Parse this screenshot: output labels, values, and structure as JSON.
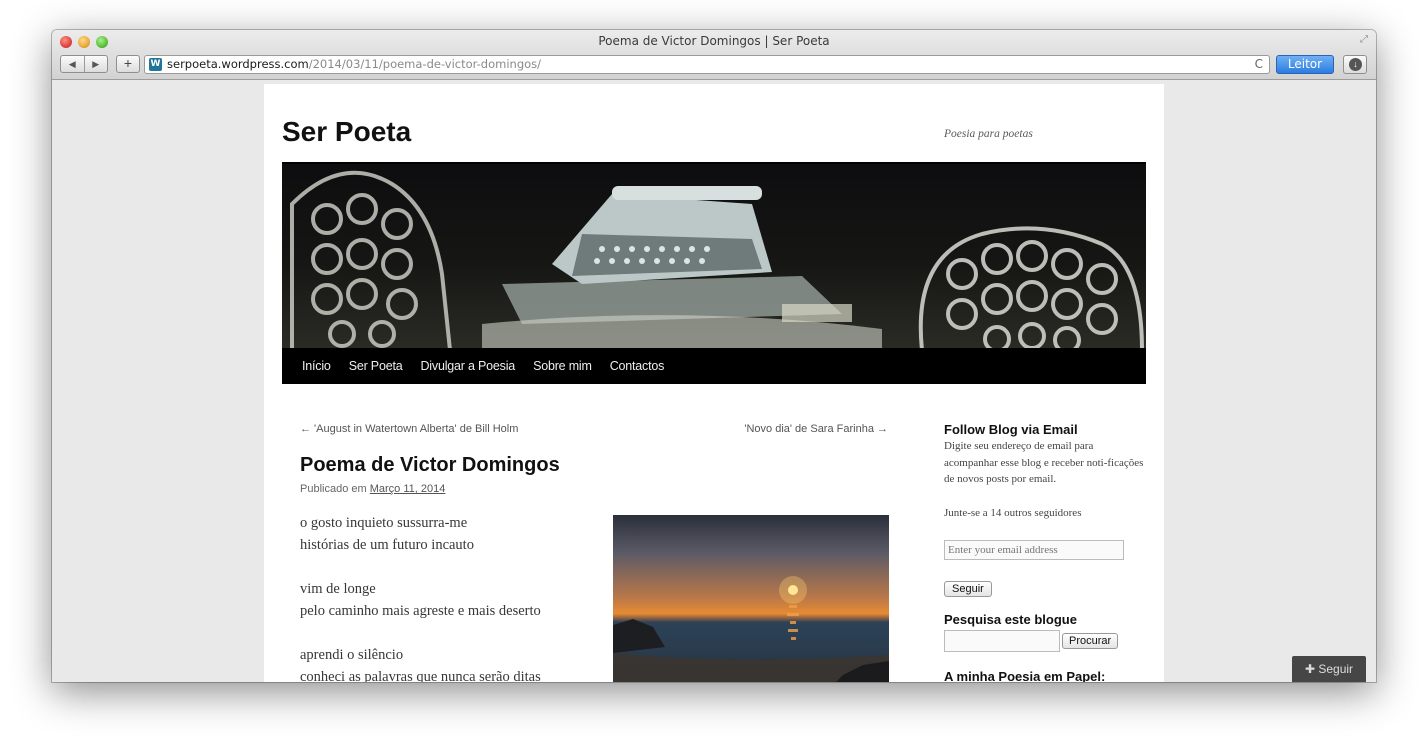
{
  "window": {
    "title": "Poema de Victor Domingos | Ser Poeta"
  },
  "toolbar": {
    "url_host": "serpoeta.wordpress.com",
    "url_path": "/2014/03/11/poema-de-victor-domingos/",
    "reader_label": "Leitor",
    "back_icon": "◀",
    "forward_icon": "▶",
    "add_icon": "+",
    "reload_icon": "C",
    "favicon_letter": "W"
  },
  "site": {
    "title": "Ser Poeta",
    "description": "Poesia para poetas",
    "menu": [
      "Início",
      "Ser Poeta",
      "Divulgar a Poesia",
      "Sobre mim",
      "Contactos"
    ]
  },
  "post": {
    "prev_link": "← 'August in Watertown Alberta' de Bill Holm",
    "next_link": "'Novo dia' de Sara Farinha →",
    "title": "Poema de Victor Domingos",
    "meta_prefix": "Publicado em",
    "date": "Março 11, 2014",
    "stanzas": [
      [
        "o gosto inquieto sussurra-me",
        "histórias de um futuro incauto"
      ],
      [
        "vim de longe",
        "pelo caminho mais agreste e mais deserto"
      ],
      [
        "aprendi o silêncio",
        "conheci as palavras que nunca serão ditas"
      ]
    ]
  },
  "sidebar": {
    "follow_title": "Follow Blog via Email",
    "follow_text": "Digite seu endereço de email para acompanhar esse blog e receber noti-ficações de novos posts por email.",
    "followers": "Junte-se a 14 outros seguidores",
    "email_placeholder": "Enter your email address",
    "follow_button": "Seguir",
    "search_title": "Pesquisa este blogue",
    "search_button": "Procurar",
    "next_widget_title": "A minha Poesia em Papel:"
  },
  "follow_badge": {
    "label": "Seguir",
    "icon": "✚"
  }
}
